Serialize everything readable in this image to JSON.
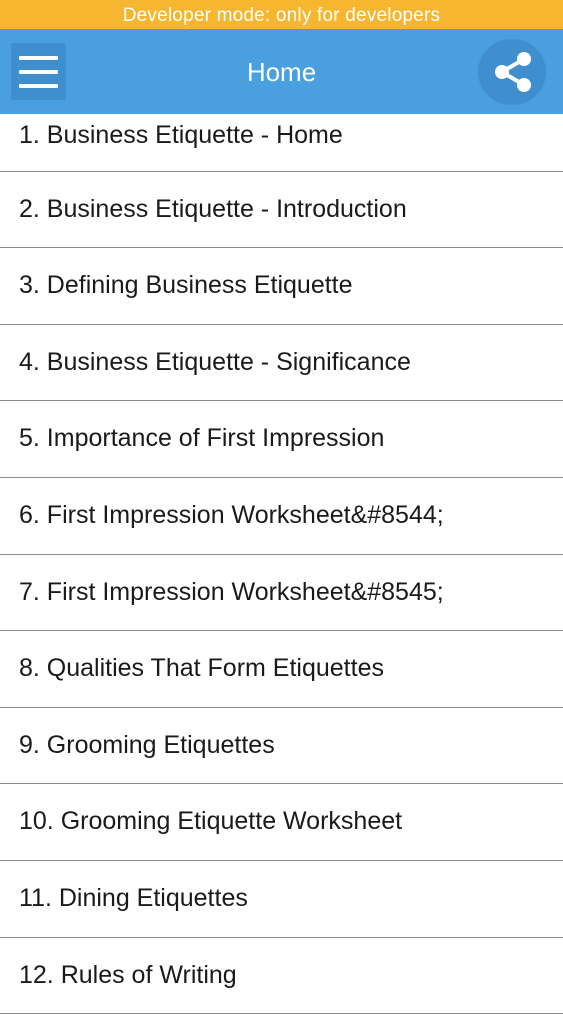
{
  "banner": {
    "text": "Developer mode: only for developers",
    "color": "#f6b630"
  },
  "app_bar": {
    "title": "Home",
    "color": "#4a9fe0",
    "menu_icon": "hamburger-menu-icon",
    "share_icon": "share-icon"
  },
  "list": {
    "items": [
      {
        "label": "1. Business Etiquette - Home"
      },
      {
        "label": "2. Business Etiquette - Introduction"
      },
      {
        "label": "3. Defining Business Etiquette"
      },
      {
        "label": "4. Business Etiquette - Significance"
      },
      {
        "label": "5. Importance of First Impression"
      },
      {
        "label": "6. First Impression Worksheet&#8544;"
      },
      {
        "label": "7. First Impression Worksheet&#8545;"
      },
      {
        "label": "8. Qualities That Form Etiquettes"
      },
      {
        "label": "9. Grooming Etiquettes"
      },
      {
        "label": "10. Grooming Etiquette Worksheet"
      },
      {
        "label": "11. Dining Etiquettes"
      },
      {
        "label": "12. Rules of Writing"
      }
    ]
  }
}
